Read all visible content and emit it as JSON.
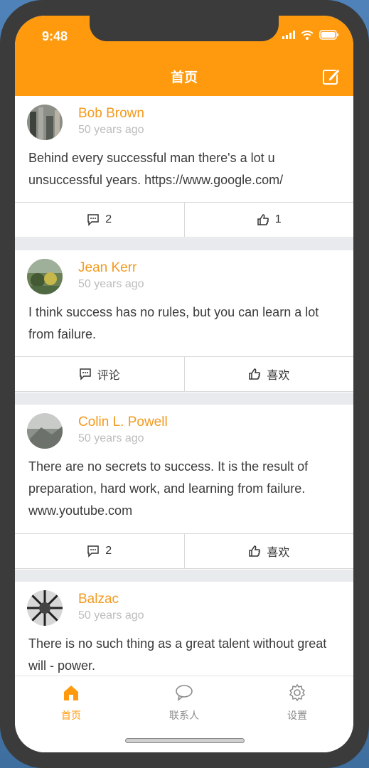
{
  "status_bar": {
    "time": "9:48"
  },
  "nav": {
    "title": "首页"
  },
  "posts": [
    {
      "author": "Bob Brown",
      "time_ago": "50 years ago",
      "text": "Behind every successful man there's a lot u unsuccessful years. https://www.google.com/",
      "comment_label": "2",
      "like_label": "1"
    },
    {
      "author": "Jean Kerr",
      "time_ago": "50 years ago",
      "text": "I think success has no rules, but you can learn a lot from failure.",
      "comment_label": "评论",
      "like_label": "喜欢"
    },
    {
      "author": "Colin L. Powell",
      "time_ago": "50 years ago",
      "text": "There are no secrets to success. It is the result of preparation, hard work, and learning from failure. www.youtube.com",
      "comment_label": "2",
      "like_label": "喜欢"
    },
    {
      "author": "Balzac",
      "time_ago": "50 years ago",
      "text": "There is no such thing as a great talent without great will - power.",
      "comment_label": "",
      "like_label": ""
    }
  ],
  "tabbar": {
    "items": [
      {
        "label": "首页",
        "icon": "home-icon"
      },
      {
        "label": "联系人",
        "icon": "chat-bubble-icon"
      },
      {
        "label": "设置",
        "icon": "gear-icon"
      }
    ]
  },
  "colors": {
    "accent": "#ff9a0e",
    "author_name": "#f39a1e",
    "muted_text": "#bcbcbc",
    "divider_background": "#e9eaee"
  }
}
